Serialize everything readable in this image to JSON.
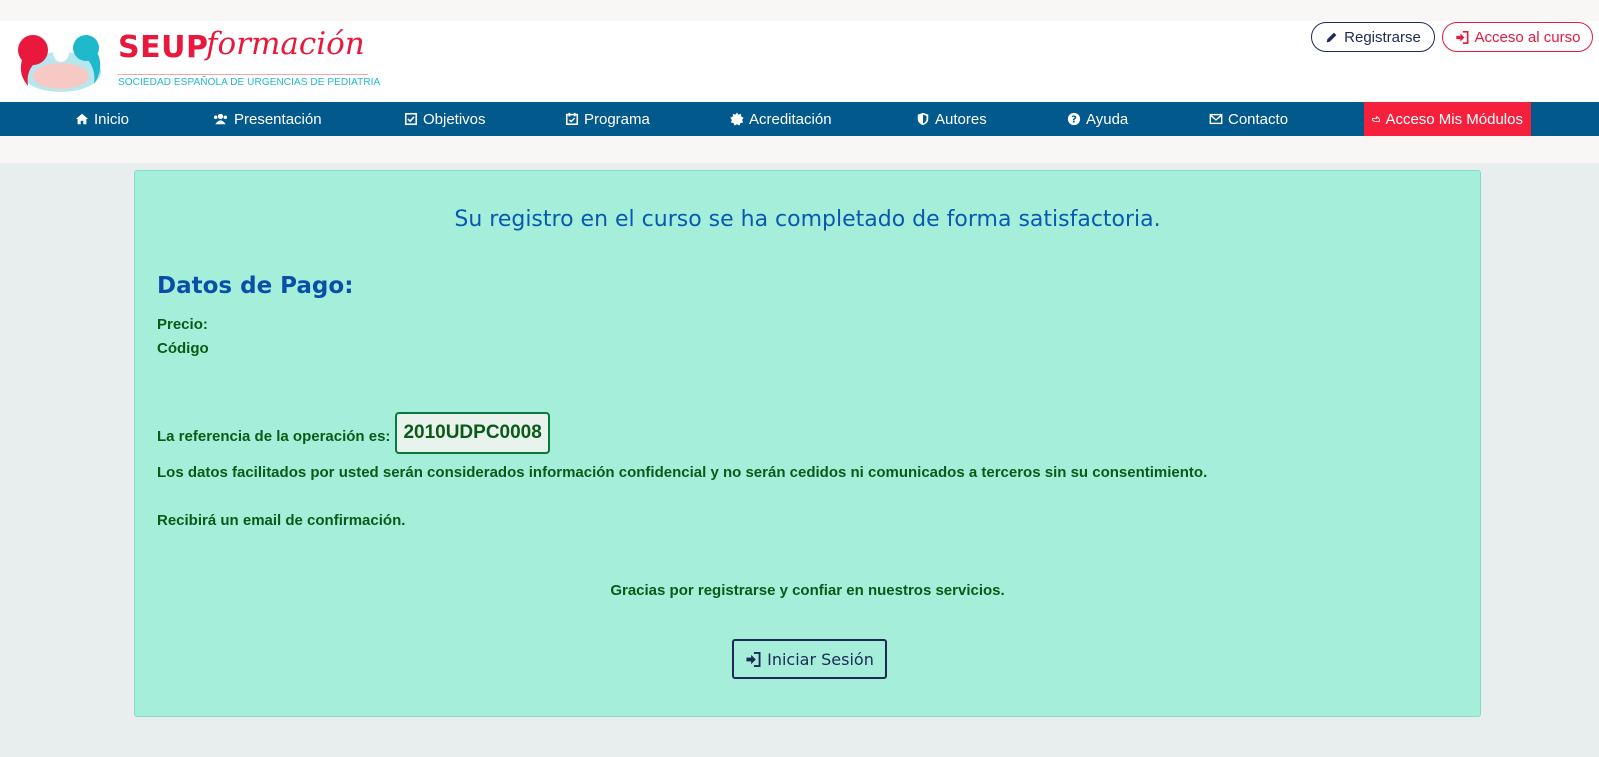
{
  "header": {
    "logo": {
      "brand": "SEUP",
      "script": "formación",
      "subtitle": "SOCIEDAD ESPAÑOLA DE URGENCIAS DE PEDIATRIA"
    },
    "buttons": {
      "register": {
        "label": "Registrarse",
        "icon": "pencil-icon"
      },
      "course_access": {
        "label": "Acceso al curso",
        "icon": "sign-in-icon"
      }
    }
  },
  "nav": {
    "items": [
      {
        "label": "Inicio",
        "icon": "home-icon"
      },
      {
        "label": "Presentación",
        "icon": "users-icon"
      },
      {
        "label": "Objetivos",
        "icon": "checkbox-icon"
      },
      {
        "label": "Programa",
        "icon": "calendar-check-icon"
      },
      {
        "label": "Acreditación",
        "icon": "certificate-icon"
      },
      {
        "label": "Autores",
        "icon": "shield-icon"
      },
      {
        "label": "Ayuda",
        "icon": "question-icon"
      },
      {
        "label": "Contacto",
        "icon": "envelope-icon"
      },
      {
        "label": "Acceso Mis Módulos",
        "icon": "hand-pointer-icon",
        "highlight": true
      }
    ]
  },
  "confirmation": {
    "title": "Su registro en el curso se ha completado de forma satisfactoria.",
    "payment_heading": "Datos de Pago:",
    "price_label": "Precio:",
    "code_label": "Código",
    "reference_label": "La referencia de la operación es:",
    "reference_code": "2010UDPC0008",
    "privacy_notice": "Los datos facilitados por usted serán considerados información confidencial y no serán cedidos ni comunicados a terceros sin su consentimiento.",
    "email_notice": "Recibirá un email de confirmación.",
    "thanks": "Gracias por registrarse y confiar en nuestros servicios.",
    "login_button": {
      "label": "Iniciar Sesión",
      "icon": "sign-in-icon"
    }
  },
  "colors": {
    "brand_red": "#e8193c",
    "brand_cyan": "#1fb9cc",
    "nav_blue": "#02598c",
    "highlight_red": "#f5213c",
    "panel_green": "#a5efda",
    "text_green": "#0b5a18",
    "title_blue": "#0a58b0"
  }
}
